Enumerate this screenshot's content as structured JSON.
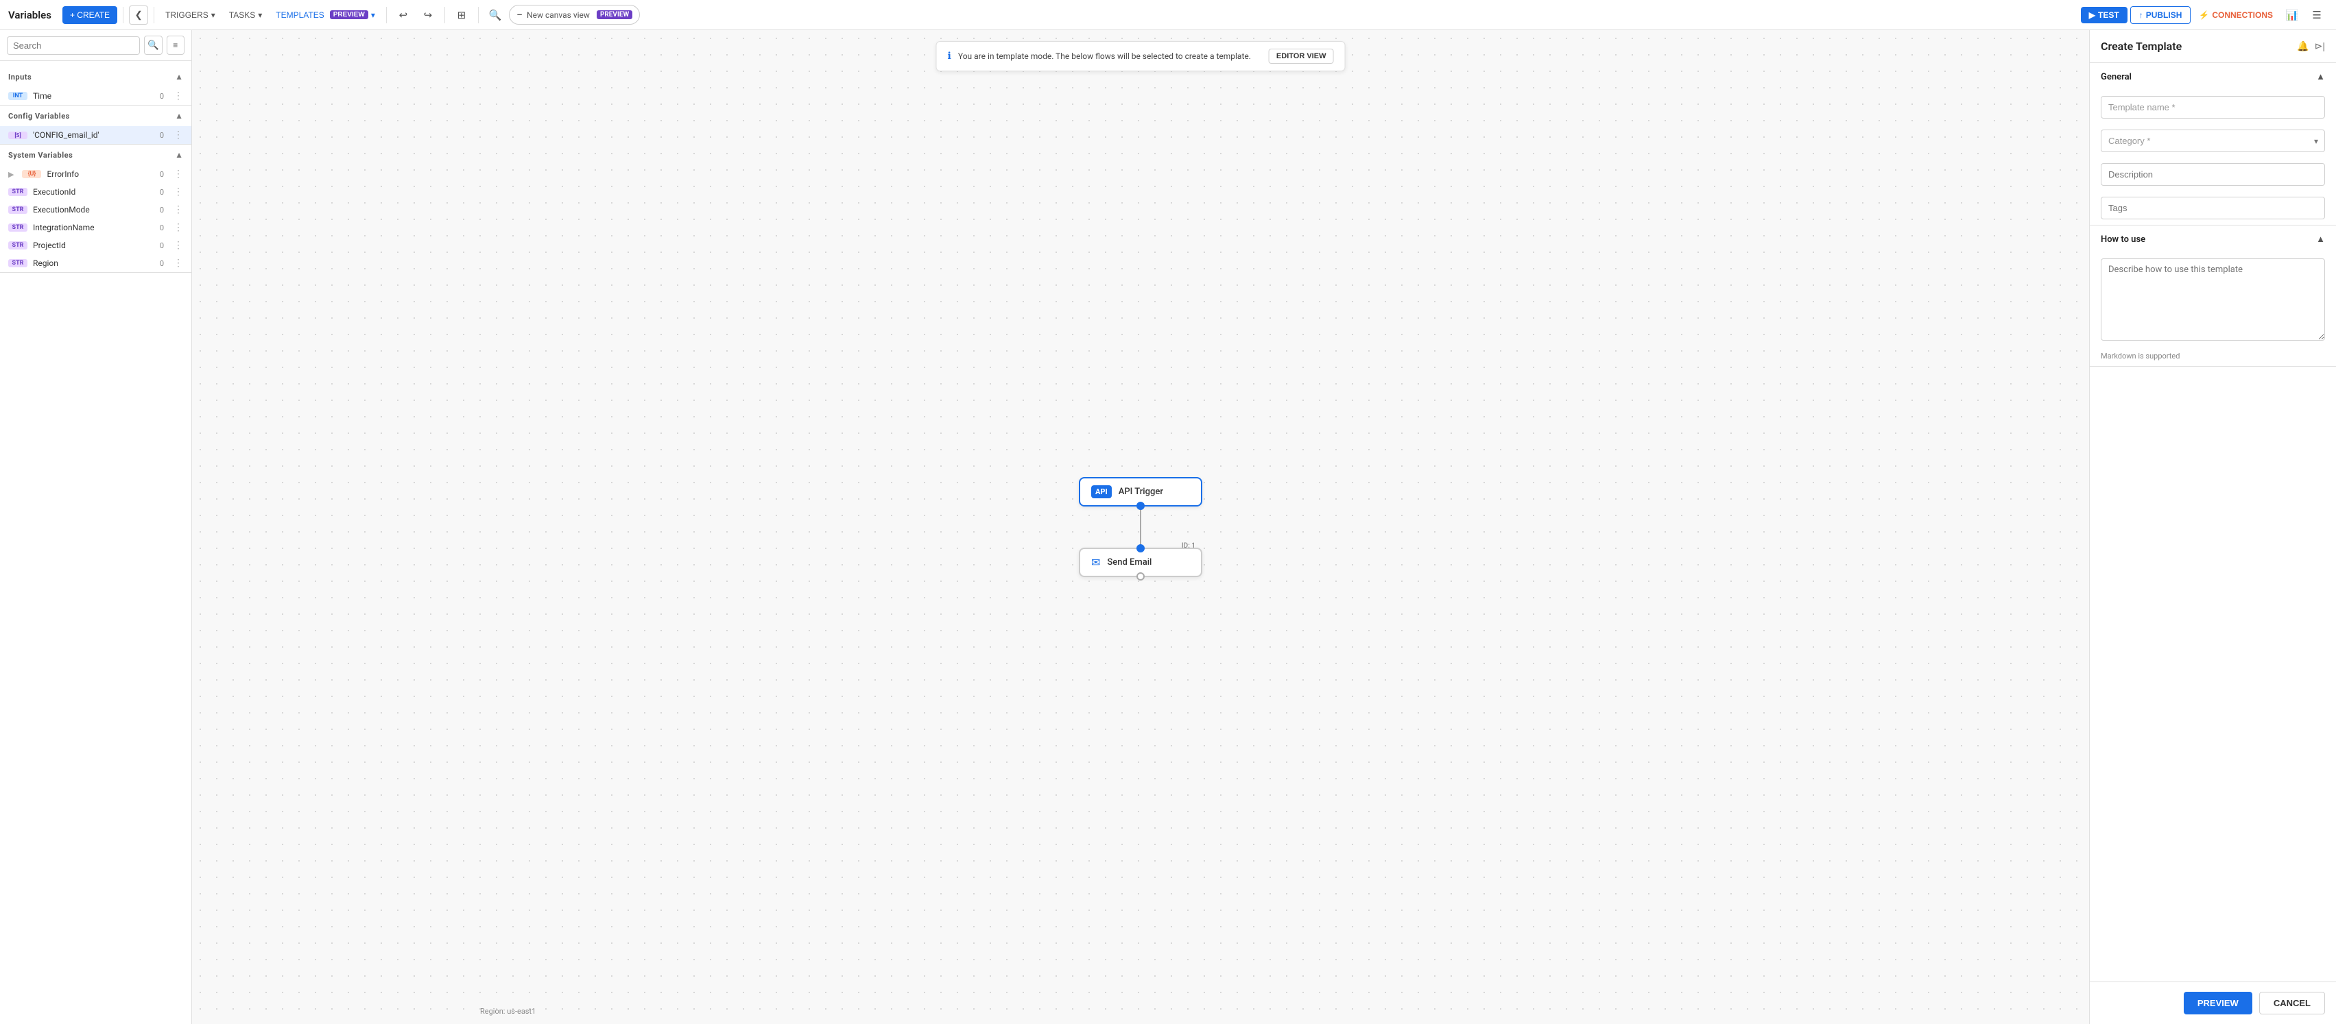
{
  "app": {
    "title": "Variables"
  },
  "topnav": {
    "create_label": "+ CREATE",
    "collapse_icon": "❮",
    "triggers_label": "TRIGGERS",
    "tasks_label": "TASKS",
    "templates_label": "TEMPLATES",
    "preview_badge": "PREVIEW",
    "undo_icon": "↩",
    "redo_icon": "↪",
    "diagram_icon": "⊞",
    "zoom_icon": "🔍",
    "minus_icon": "−",
    "canvas_view_label": "New canvas view",
    "canvas_preview_badge": "PREVIEW",
    "test_label": "TEST",
    "publish_label": "PUBLISH",
    "connections_label": "CONNECTIONS",
    "chart_icon": "📊",
    "menu_icon": "☰"
  },
  "sidebar": {
    "search_placeholder": "Search",
    "sections": {
      "inputs": {
        "title": "Inputs",
        "items": [
          {
            "type": "INT",
            "name": "Time",
            "count": "0"
          }
        ]
      },
      "config_variables": {
        "title": "Config Variables",
        "items": [
          {
            "type": "S|",
            "name": "'CONFIG_email_id'",
            "count": "0",
            "selected": true
          }
        ]
      },
      "system_variables": {
        "title": "System Variables",
        "items": [
          {
            "type": "{U}",
            "name": "ErrorInfo",
            "count": "0",
            "expandable": true
          },
          {
            "type": "STR",
            "name": "ExecutionId",
            "count": "0"
          },
          {
            "type": "STR",
            "name": "ExecutionMode",
            "count": "0"
          },
          {
            "type": "STR",
            "name": "IntegrationName",
            "count": "0"
          },
          {
            "type": "STR",
            "name": "ProjectId",
            "count": "0"
          },
          {
            "type": "STR",
            "name": "Region",
            "count": "0"
          }
        ]
      }
    }
  },
  "canvas": {
    "banner_text": "You are in template mode. The below flows will be selected to create a template.",
    "editor_view_btn": "EDITOR VIEW",
    "nodes": [
      {
        "id": "api-trigger",
        "label": "API Trigger",
        "type": "api"
      },
      {
        "id": "send-email",
        "label": "Send Email",
        "type": "email",
        "node_id": "ID: 1"
      }
    ],
    "region_label": "Region: us-east1"
  },
  "right_panel": {
    "title": "Create Template",
    "sections": {
      "general": {
        "title": "General",
        "fields": {
          "template_name": {
            "placeholder": "Template name",
            "required": true
          },
          "category": {
            "placeholder": "Category",
            "required": true
          },
          "description": {
            "placeholder": "Description"
          },
          "tags": {
            "placeholder": "Tags"
          }
        }
      },
      "how_to_use": {
        "title": "How to use",
        "textarea_placeholder": "Describe how to use this template",
        "markdown_note": "Markdown is supported"
      }
    },
    "footer": {
      "preview_label": "PREVIEW",
      "cancel_label": "CANCEL"
    }
  }
}
